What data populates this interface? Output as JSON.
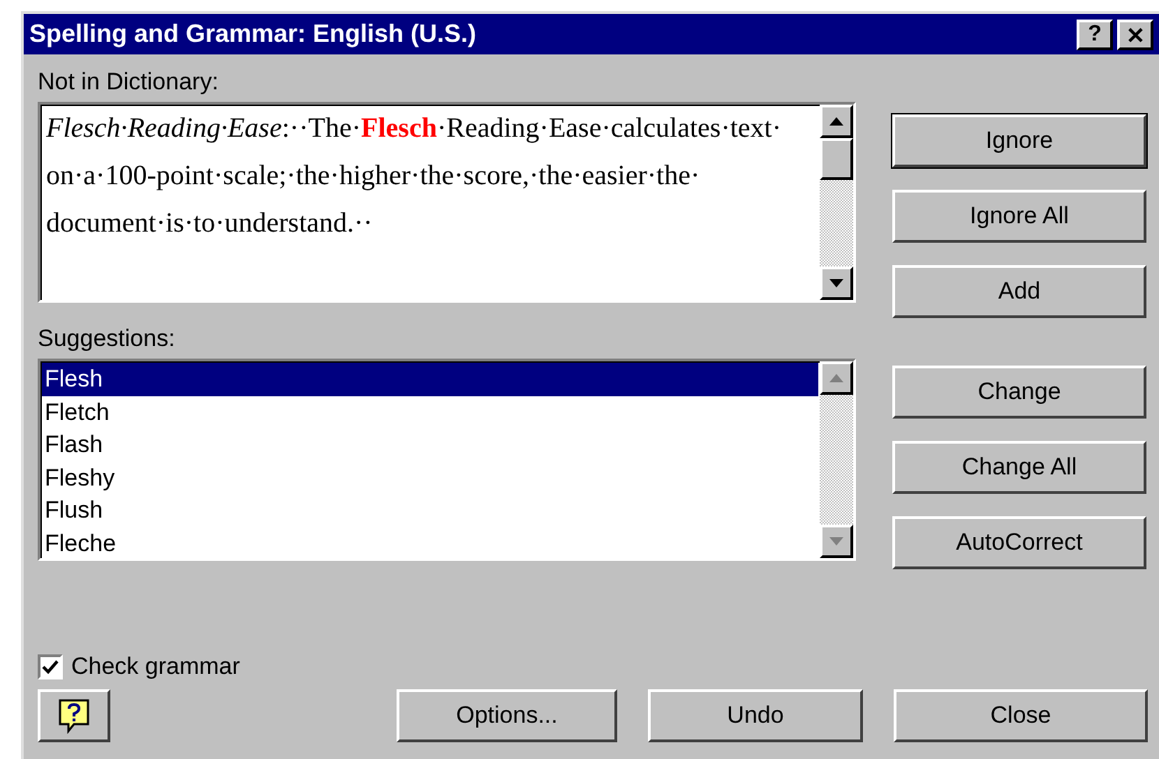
{
  "window": {
    "title": "Spelling and Grammar: English (U.S.)",
    "title_buttons": [
      "?",
      "✕"
    ]
  },
  "not_in_dictionary": {
    "label": "Not in Dictionary:",
    "text": "*Flesch·Reading·Ease*:··The·**Flesch**·Reading·Ease·calculates·text·on·a·100-point·scale;·the·higher·the·score,·the·easier·the·document·is·to·understand.··"
  },
  "suggestions": {
    "label": "Suggestions:",
    "items": [
      {
        "text": "Flesh",
        "selected": true
      },
      {
        "text": "Fletch",
        "selected": false
      },
      {
        "text": "Flash",
        "selected": false
      },
      {
        "text": "Fleshy",
        "selected": false
      },
      {
        "text": "Flush",
        "selected": false
      },
      {
        "text": "Fleche",
        "selected": false
      }
    ]
  },
  "side_buttons": [
    {
      "label": "Ignore",
      "focused": true
    },
    {
      "label": "Ignore All",
      "focused": false
    },
    {
      "label": "Add",
      "focused": false
    },
    {
      "label": "Change",
      "focused": false
    },
    {
      "label": "Change All",
      "focused": false
    },
    {
      "label": "AutoCorrect",
      "focused": false
    }
  ],
  "check_grammar": {
    "label": "Check grammar",
    "checked": true
  },
  "bottom_buttons": [
    "Options...",
    "Undo",
    "Close"
  ]
}
